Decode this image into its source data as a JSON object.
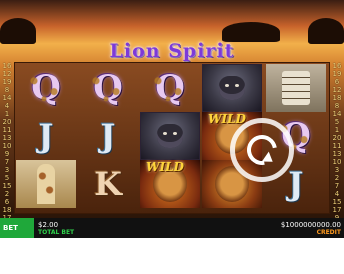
{
  "game": {
    "title": "Lion Spirit",
    "left_numbers": [
      "16",
      "12",
      "19",
      "8",
      "14",
      "4",
      "1",
      "20",
      "11",
      "13",
      "10",
      "9",
      "7",
      "3",
      "5",
      "15",
      "2",
      "6",
      "18",
      "17"
    ],
    "right_numbers": [
      "16",
      "19",
      "6",
      "12",
      "18",
      "8",
      "14",
      "5",
      "1",
      "20",
      "11",
      "13",
      "10",
      "3",
      "2",
      "7",
      "4",
      "15",
      "17",
      "9"
    ],
    "side_left_big": [
      "19",
      "20"
    ],
    "side_right_big": [
      "19",
      "20"
    ],
    "reels": [
      [
        "Q",
        "J",
        "giraffe"
      ],
      [
        "Q",
        "J",
        "K"
      ],
      [
        "Q",
        "gorilla",
        "wild-lion"
      ],
      [
        "gorilla",
        "wild",
        "lion"
      ],
      [
        "totem",
        "Q",
        "J"
      ]
    ],
    "wild_label": "WILD"
  },
  "footer": {
    "bet_button_label": "BET",
    "total_bet_value": "$2.00",
    "total_bet_label": "TOTAL BET",
    "credit_value": "$1000000000.00",
    "credit_label": "CREDIT"
  },
  "icons": {
    "spin": "spin-icon"
  }
}
